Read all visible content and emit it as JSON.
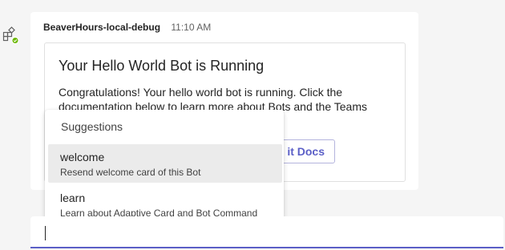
{
  "message": {
    "sender": "BeaverHours-local-debug",
    "time": "11:10 AM"
  },
  "card": {
    "title": "Your Hello World Bot is Running",
    "body": "Congratulations! Your hello world bot is running. Click the documentation below to learn more about Bots and the Teams",
    "button_label": "it Docs"
  },
  "suggestions": {
    "title": "Suggestions",
    "items": [
      {
        "command": "welcome",
        "description": "Resend welcome card of this Bot",
        "active": true
      },
      {
        "command": "learn",
        "description": "Learn about Adaptive Card and Bot Command",
        "active": false
      }
    ]
  },
  "colors": {
    "accent": "#5b5fc7",
    "online": "#6bb700",
    "hover": "#ebebeb"
  },
  "icons": {
    "bot_avatar": "apps-grid-icon",
    "status": "available-check-icon"
  }
}
